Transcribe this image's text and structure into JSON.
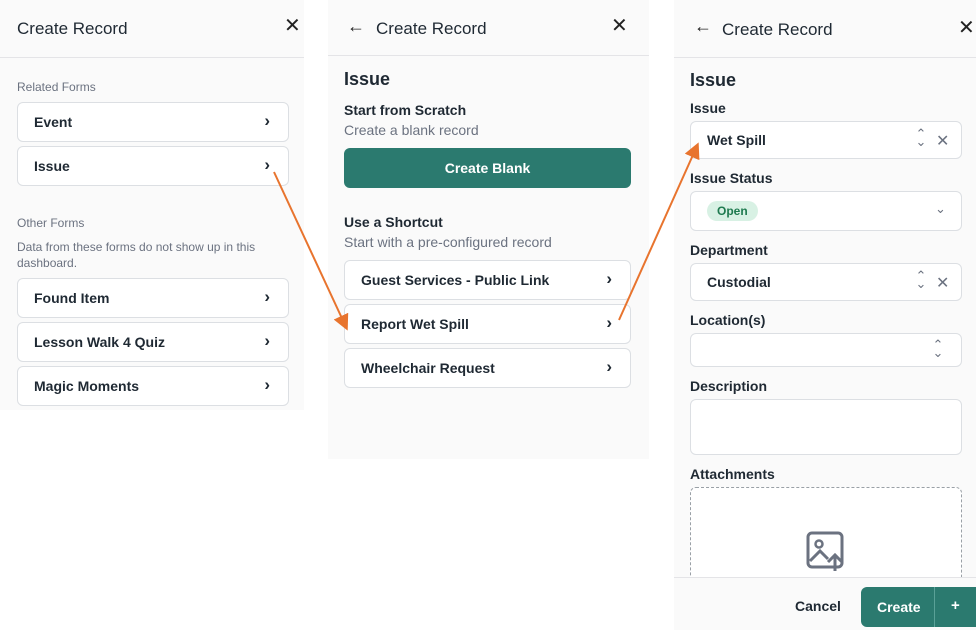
{
  "colors": {
    "accent": "#2b7a6f",
    "arrow": "#e8742e",
    "badge_bg": "#d8f1e4",
    "badge_text": "#1e7a4f"
  },
  "panel1": {
    "title": "Create Record",
    "related_label": "Related Forms",
    "related": [
      {
        "label": "Event"
      },
      {
        "label": "Issue"
      }
    ],
    "other_label": "Other Forms",
    "other_hint": "Data from these forms do not show up in this dashboard.",
    "other": [
      {
        "label": "Found Item"
      },
      {
        "label": "Lesson Walk 4 Quiz"
      },
      {
        "label": "Magic Moments"
      }
    ]
  },
  "panel2": {
    "title": "Create Record",
    "heading": "Issue",
    "scratch_title": "Start from Scratch",
    "scratch_sub": "Create a blank record",
    "create_blank": "Create Blank",
    "shortcut_title": "Use a Shortcut",
    "shortcut_sub": "Start with a pre-configured record",
    "shortcuts": [
      {
        "label": "Guest Services - Public Link"
      },
      {
        "label": "Report Wet Spill"
      },
      {
        "label": "Wheelchair Request"
      }
    ]
  },
  "panel3": {
    "title": "Create Record",
    "heading": "Issue",
    "fields": {
      "issue": {
        "label": "Issue",
        "value": "Wet Spill"
      },
      "status": {
        "label": "Issue Status",
        "value": "Open"
      },
      "department": {
        "label": "Department",
        "value": "Custodial"
      },
      "location": {
        "label": "Location(s)",
        "value": ""
      },
      "description": {
        "label": "Description",
        "value": ""
      },
      "attachments": {
        "label": "Attachments"
      }
    },
    "cancel": "Cancel",
    "create": "Create",
    "create_plus": "+"
  }
}
